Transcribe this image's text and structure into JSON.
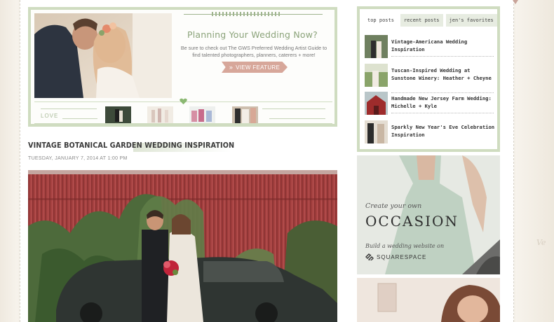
{
  "banner": {
    "heading": "Planning Your Wedding Now?",
    "subtext": "Be sure to check out The GWS Preferred Wedding Artist Guide to find talented photographers, planners, caterers + more!",
    "button_label": "VIEW FEATURE",
    "love_label": "LOVE"
  },
  "post": {
    "title": "VINTAGE BOTANICAL GARDEN WEDDING INSPIRATION",
    "date": "TUESDAY, JANUARY 7, 2014 AT 1:00 PM"
  },
  "sidebar": {
    "tabs": [
      "top posts",
      "recent posts",
      "jen's favorites"
    ],
    "posts": [
      {
        "title": "Vintage-Americana Wedding Inspiration"
      },
      {
        "title": "Tuscan-Inspired Wedding at Sunstone Winery: Heather + Cheyne"
      },
      {
        "title": "Handmade New Jersey Farm Wedding: Michelle + Kyle"
      },
      {
        "title": "Sparkly New Year's Eve Celebration Inspiration"
      }
    ]
  },
  "ad": {
    "create": "Create your own",
    "occasion": "OCCASION",
    "build": "Build a wedding website on",
    "brand": "SQUARESPACE"
  },
  "colors": {
    "sage": "#cfdcc0",
    "sage_text": "#8ba37a",
    "blush": "#d7a79a",
    "barn_red": "#a23f3f"
  }
}
